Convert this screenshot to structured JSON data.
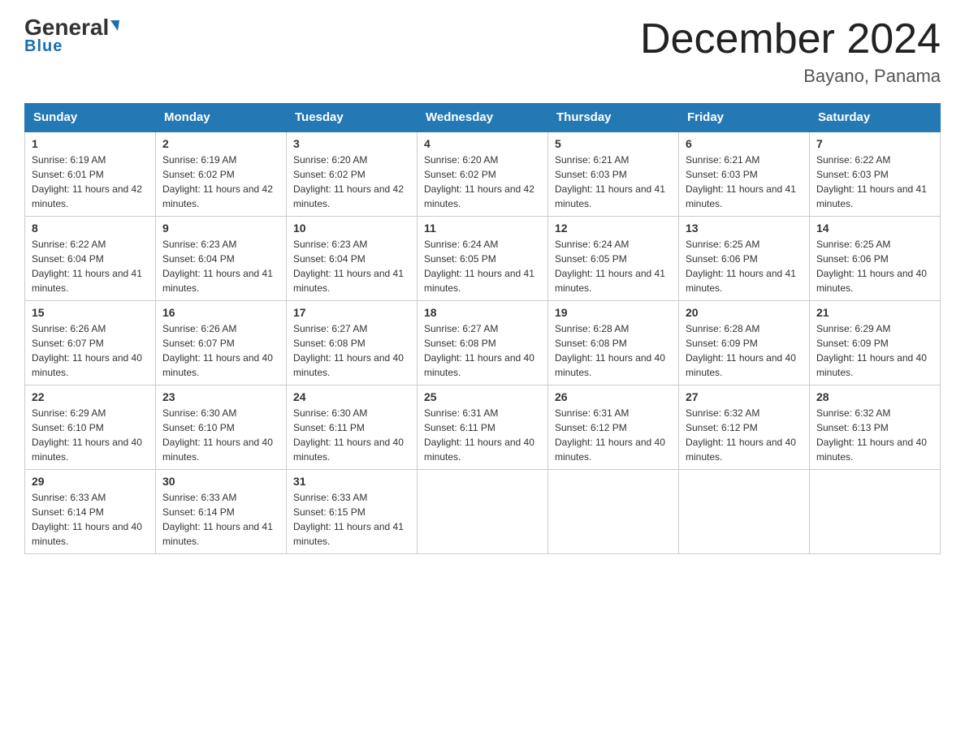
{
  "header": {
    "logo_general": "General",
    "logo_blue": "Blue",
    "month_year": "December 2024",
    "location": "Bayano, Panama"
  },
  "days_of_week": [
    "Sunday",
    "Monday",
    "Tuesday",
    "Wednesday",
    "Thursday",
    "Friday",
    "Saturday"
  ],
  "weeks": [
    [
      {
        "day": "1",
        "sunrise": "6:19 AM",
        "sunset": "6:01 PM",
        "daylight": "11 hours and 42 minutes."
      },
      {
        "day": "2",
        "sunrise": "6:19 AM",
        "sunset": "6:02 PM",
        "daylight": "11 hours and 42 minutes."
      },
      {
        "day": "3",
        "sunrise": "6:20 AM",
        "sunset": "6:02 PM",
        "daylight": "11 hours and 42 minutes."
      },
      {
        "day": "4",
        "sunrise": "6:20 AM",
        "sunset": "6:02 PM",
        "daylight": "11 hours and 42 minutes."
      },
      {
        "day": "5",
        "sunrise": "6:21 AM",
        "sunset": "6:03 PM",
        "daylight": "11 hours and 41 minutes."
      },
      {
        "day": "6",
        "sunrise": "6:21 AM",
        "sunset": "6:03 PM",
        "daylight": "11 hours and 41 minutes."
      },
      {
        "day": "7",
        "sunrise": "6:22 AM",
        "sunset": "6:03 PM",
        "daylight": "11 hours and 41 minutes."
      }
    ],
    [
      {
        "day": "8",
        "sunrise": "6:22 AM",
        "sunset": "6:04 PM",
        "daylight": "11 hours and 41 minutes."
      },
      {
        "day": "9",
        "sunrise": "6:23 AM",
        "sunset": "6:04 PM",
        "daylight": "11 hours and 41 minutes."
      },
      {
        "day": "10",
        "sunrise": "6:23 AM",
        "sunset": "6:04 PM",
        "daylight": "11 hours and 41 minutes."
      },
      {
        "day": "11",
        "sunrise": "6:24 AM",
        "sunset": "6:05 PM",
        "daylight": "11 hours and 41 minutes."
      },
      {
        "day": "12",
        "sunrise": "6:24 AM",
        "sunset": "6:05 PM",
        "daylight": "11 hours and 41 minutes."
      },
      {
        "day": "13",
        "sunrise": "6:25 AM",
        "sunset": "6:06 PM",
        "daylight": "11 hours and 41 minutes."
      },
      {
        "day": "14",
        "sunrise": "6:25 AM",
        "sunset": "6:06 PM",
        "daylight": "11 hours and 40 minutes."
      }
    ],
    [
      {
        "day": "15",
        "sunrise": "6:26 AM",
        "sunset": "6:07 PM",
        "daylight": "11 hours and 40 minutes."
      },
      {
        "day": "16",
        "sunrise": "6:26 AM",
        "sunset": "6:07 PM",
        "daylight": "11 hours and 40 minutes."
      },
      {
        "day": "17",
        "sunrise": "6:27 AM",
        "sunset": "6:08 PM",
        "daylight": "11 hours and 40 minutes."
      },
      {
        "day": "18",
        "sunrise": "6:27 AM",
        "sunset": "6:08 PM",
        "daylight": "11 hours and 40 minutes."
      },
      {
        "day": "19",
        "sunrise": "6:28 AM",
        "sunset": "6:08 PM",
        "daylight": "11 hours and 40 minutes."
      },
      {
        "day": "20",
        "sunrise": "6:28 AM",
        "sunset": "6:09 PM",
        "daylight": "11 hours and 40 minutes."
      },
      {
        "day": "21",
        "sunrise": "6:29 AM",
        "sunset": "6:09 PM",
        "daylight": "11 hours and 40 minutes."
      }
    ],
    [
      {
        "day": "22",
        "sunrise": "6:29 AM",
        "sunset": "6:10 PM",
        "daylight": "11 hours and 40 minutes."
      },
      {
        "day": "23",
        "sunrise": "6:30 AM",
        "sunset": "6:10 PM",
        "daylight": "11 hours and 40 minutes."
      },
      {
        "day": "24",
        "sunrise": "6:30 AM",
        "sunset": "6:11 PM",
        "daylight": "11 hours and 40 minutes."
      },
      {
        "day": "25",
        "sunrise": "6:31 AM",
        "sunset": "6:11 PM",
        "daylight": "11 hours and 40 minutes."
      },
      {
        "day": "26",
        "sunrise": "6:31 AM",
        "sunset": "6:12 PM",
        "daylight": "11 hours and 40 minutes."
      },
      {
        "day": "27",
        "sunrise": "6:32 AM",
        "sunset": "6:12 PM",
        "daylight": "11 hours and 40 minutes."
      },
      {
        "day": "28",
        "sunrise": "6:32 AM",
        "sunset": "6:13 PM",
        "daylight": "11 hours and 40 minutes."
      }
    ],
    [
      {
        "day": "29",
        "sunrise": "6:33 AM",
        "sunset": "6:14 PM",
        "daylight": "11 hours and 40 minutes."
      },
      {
        "day": "30",
        "sunrise": "6:33 AM",
        "sunset": "6:14 PM",
        "daylight": "11 hours and 41 minutes."
      },
      {
        "day": "31",
        "sunrise": "6:33 AM",
        "sunset": "6:15 PM",
        "daylight": "11 hours and 41 minutes."
      },
      null,
      null,
      null,
      null
    ]
  ]
}
